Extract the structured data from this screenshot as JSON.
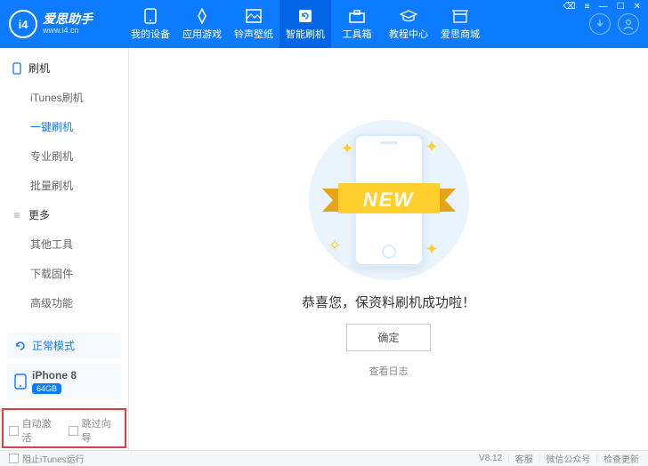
{
  "brand": {
    "name": "爱思助手",
    "url": "www.i4.cn",
    "logo_glyph": "i4"
  },
  "win_controls": [
    "⌫",
    "≡",
    "—",
    "☐",
    "✕"
  ],
  "nav": [
    {
      "label": "我的设备"
    },
    {
      "label": "应用游戏"
    },
    {
      "label": "铃声壁纸"
    },
    {
      "label": "智能刷机",
      "active": true
    },
    {
      "label": "工具箱"
    },
    {
      "label": "教程中心"
    },
    {
      "label": "爱思商城"
    }
  ],
  "sidebar": {
    "section1": {
      "title": "刷机",
      "items": [
        "iTunes刷机",
        "一键刷机",
        "专业刷机",
        "批量刷机"
      ],
      "active_index": 1
    },
    "section2": {
      "title": "更多",
      "items": [
        "其他工具",
        "下载固件",
        "高级功能"
      ]
    },
    "mode": "正常模式",
    "device": {
      "name": "iPhone 8",
      "storage": "64GB"
    },
    "bottom_opts": [
      "自动激活",
      "跳过向导"
    ]
  },
  "main": {
    "ribbon_text": "NEW",
    "success_message": "恭喜您，保资料刷机成功啦！",
    "ok_button": "确定",
    "view_log": "查看日志"
  },
  "footer": {
    "block_itunes": "阻止iTunes运行",
    "version": "V8.12",
    "links": [
      "客服",
      "微信公众号",
      "检查更新"
    ]
  }
}
